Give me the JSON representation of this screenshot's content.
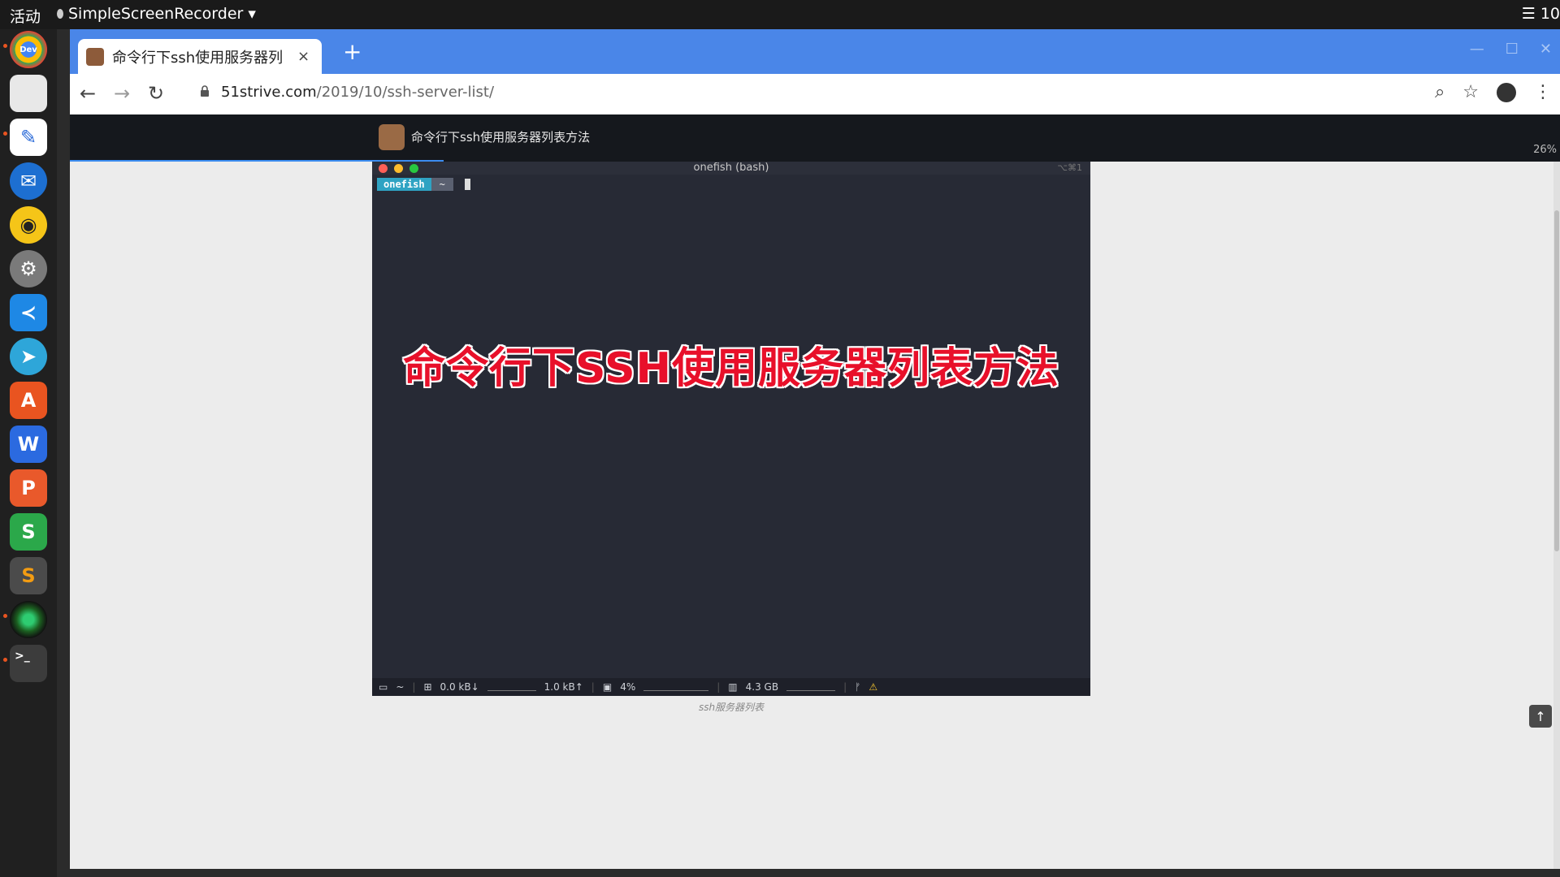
{
  "topbar": {
    "activities": "活动",
    "app_name": "SimpleScreenRecorder",
    "app_menu_icon": "triangle-down",
    "right_text": "☰ 10"
  },
  "dock": {
    "items": [
      {
        "name": "chrome-dev-icon",
        "label": "Dev",
        "color": "#d93025"
      },
      {
        "name": "files-icon",
        "label": "",
        "color": "#e8e8e8"
      },
      {
        "name": "text-editor-icon",
        "label": "",
        "color": "#ffffff"
      },
      {
        "name": "thunderbird-icon",
        "label": "",
        "color": "#1d6fd1"
      },
      {
        "name": "rhythmbox-icon",
        "label": "",
        "color": "#f5c518"
      },
      {
        "name": "settings-icon",
        "label": "",
        "color": "#7a7a7a"
      },
      {
        "name": "vscode-icon",
        "label": "",
        "color": "#1e88e5"
      },
      {
        "name": "telegram-icon",
        "label": "",
        "color": "#2ea6d9"
      },
      {
        "name": "software-center-icon",
        "label": "A",
        "color": "#e95420"
      },
      {
        "name": "wps-writer-icon",
        "label": "W",
        "color": "#2b6ae0"
      },
      {
        "name": "wps-presentation-icon",
        "label": "P",
        "color": "#e9592b"
      },
      {
        "name": "wps-spreadsheet-icon",
        "label": "S",
        "color": "#2ba84a"
      },
      {
        "name": "sublime-text-icon",
        "label": "S",
        "color": "#4b4b4b"
      },
      {
        "name": "screen-recorder-icon",
        "label": "",
        "color": "#3a3a3a"
      },
      {
        "name": "terminal-icon",
        "label": ">_",
        "color": "#3c3c3c"
      }
    ]
  },
  "browser": {
    "tab_title": "命令行下ssh使用服务器列",
    "tab_close": "×",
    "new_tab": "+",
    "url_domain": "51strive.com",
    "url_path": "/2019/10/ssh-server-list/",
    "accent": "#4a86e8"
  },
  "page": {
    "site_title": "命令行下ssh使用服务器列表方法",
    "read_progress": "26%",
    "caption": "ssh服务器列表"
  },
  "terminal": {
    "title": "onefish (bash)",
    "shortcut": "⌥⌘1",
    "prompt_user": "onefish",
    "prompt_dir": "~",
    "overlay_text": "命令行下SSH使用服务器列表方法",
    "status": {
      "dir": "~",
      "down": "0.0 kB↓",
      "up": "1.0 kB↑",
      "cpu": "4%",
      "mem": "4.3 GB"
    }
  }
}
